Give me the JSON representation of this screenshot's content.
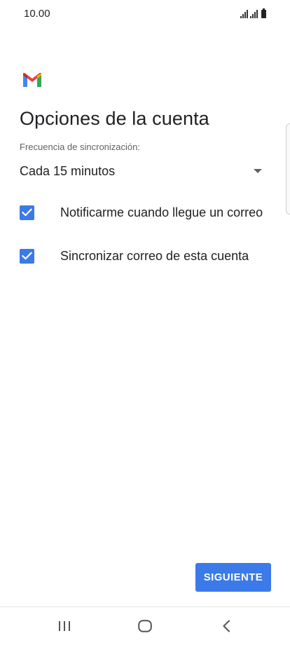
{
  "status_bar": {
    "time": "10.00"
  },
  "app": {
    "logo_icon": "gmail-m-logo"
  },
  "page": {
    "title": "Opciones de la cuenta"
  },
  "sync": {
    "label": "Frecuencia de sincronización:",
    "selected": "Cada 15 minutos"
  },
  "options": [
    {
      "label": "Notificarme cuando llegue un correo",
      "checked": true
    },
    {
      "label": "Sincronizar correo de esta cuenta",
      "checked": true
    }
  ],
  "actions": {
    "next_label": "SIGUIENTE"
  },
  "colors": {
    "accent": "#3b7ae8",
    "text_primary": "#202124",
    "text_secondary": "#5f6368"
  }
}
